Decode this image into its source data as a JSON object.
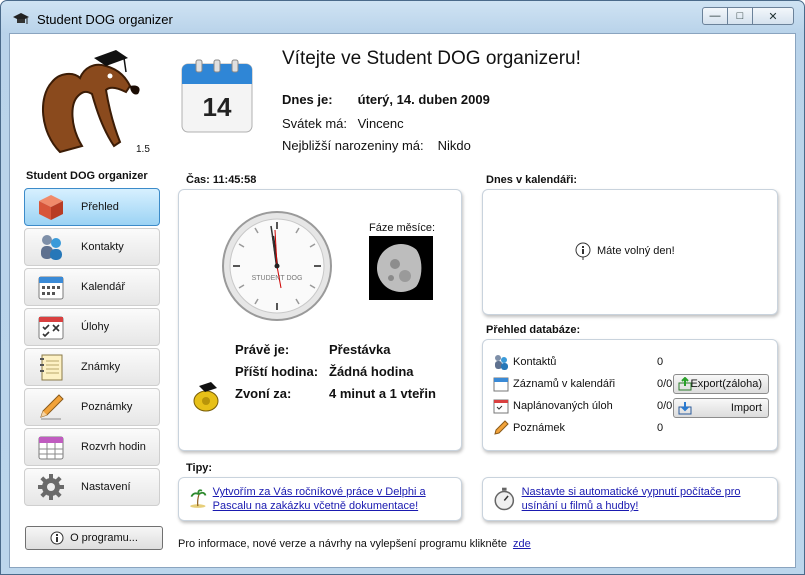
{
  "window": {
    "title": "Student DOG organizer",
    "caption": {
      "minimize": "—",
      "maximize": "□",
      "close": "✕"
    }
  },
  "sidebar": {
    "version": "1.5",
    "title": "Student DOG organizer",
    "items": [
      {
        "label": "Přehled",
        "icon": "box-icon"
      },
      {
        "label": "Kontakty",
        "icon": "people-icon"
      },
      {
        "label": "Kalendář",
        "icon": "calendar-icon"
      },
      {
        "label": "Úlohy",
        "icon": "tasks-icon"
      },
      {
        "label": "Známky",
        "icon": "notebook-icon"
      },
      {
        "label": "Poznámky",
        "icon": "pencil-icon"
      },
      {
        "label": "Rozvrh hodin",
        "icon": "schedule-icon"
      },
      {
        "label": "Nastavení",
        "icon": "gear-icon"
      }
    ],
    "active_index": 0,
    "about_label": "O programu..."
  },
  "header": {
    "calendar_day": "14",
    "welcome": "Vítejte ve Student DOG organizeru!",
    "today_label": "Dnes je:",
    "today_value": "úterý, 14. duben 2009",
    "nameday_label": "Svátek má:",
    "nameday_value": "Vincenc",
    "birthday_label": "Nejbližší narozeniny má:",
    "birthday_value": "Nikdo"
  },
  "clock_panel": {
    "title": "Čas: 11:45:58",
    "clock_brand": "STUDENT DOG",
    "moon_label": "Fáze měsíce:",
    "current_label": "Právě je:",
    "current_value": "Přestávka",
    "next_label": "Příští hodina:",
    "next_value": "Žádná hodina",
    "bell_label": "Zvoní za:",
    "bell_value": "4 minut a 1 vteřin"
  },
  "calendar_panel": {
    "title": "Dnes v kalendáři:",
    "message": "Máte volný den!"
  },
  "db_panel": {
    "title": "Přehled databáze:",
    "rows": [
      {
        "label": "Kontaktů",
        "value": "0",
        "icon": "people-icon"
      },
      {
        "label": "Záznamů v kalendáři",
        "value": "0/0",
        "icon": "calendar-icon"
      },
      {
        "label": "Naplánovaných úloh",
        "value": "0/0",
        "icon": "tasks-icon"
      },
      {
        "label": "Poznámek",
        "value": "0",
        "icon": "pencil-icon"
      }
    ],
    "export_label": "Export(záloha)",
    "import_label": "Import"
  },
  "tips": {
    "title": "Tipy:",
    "tip1": "Vytvořím za Vás ročníkové práce v Delphi a Pascalu na zakázku včetně dokumentace!",
    "tip2": "Nastavte si automatické vypnutí počítače pro usínání u filmů a hudby!"
  },
  "footer": {
    "text": "Pro informace, nové verze a návrhy na vylepšení programu klikněte",
    "link": "zde"
  }
}
